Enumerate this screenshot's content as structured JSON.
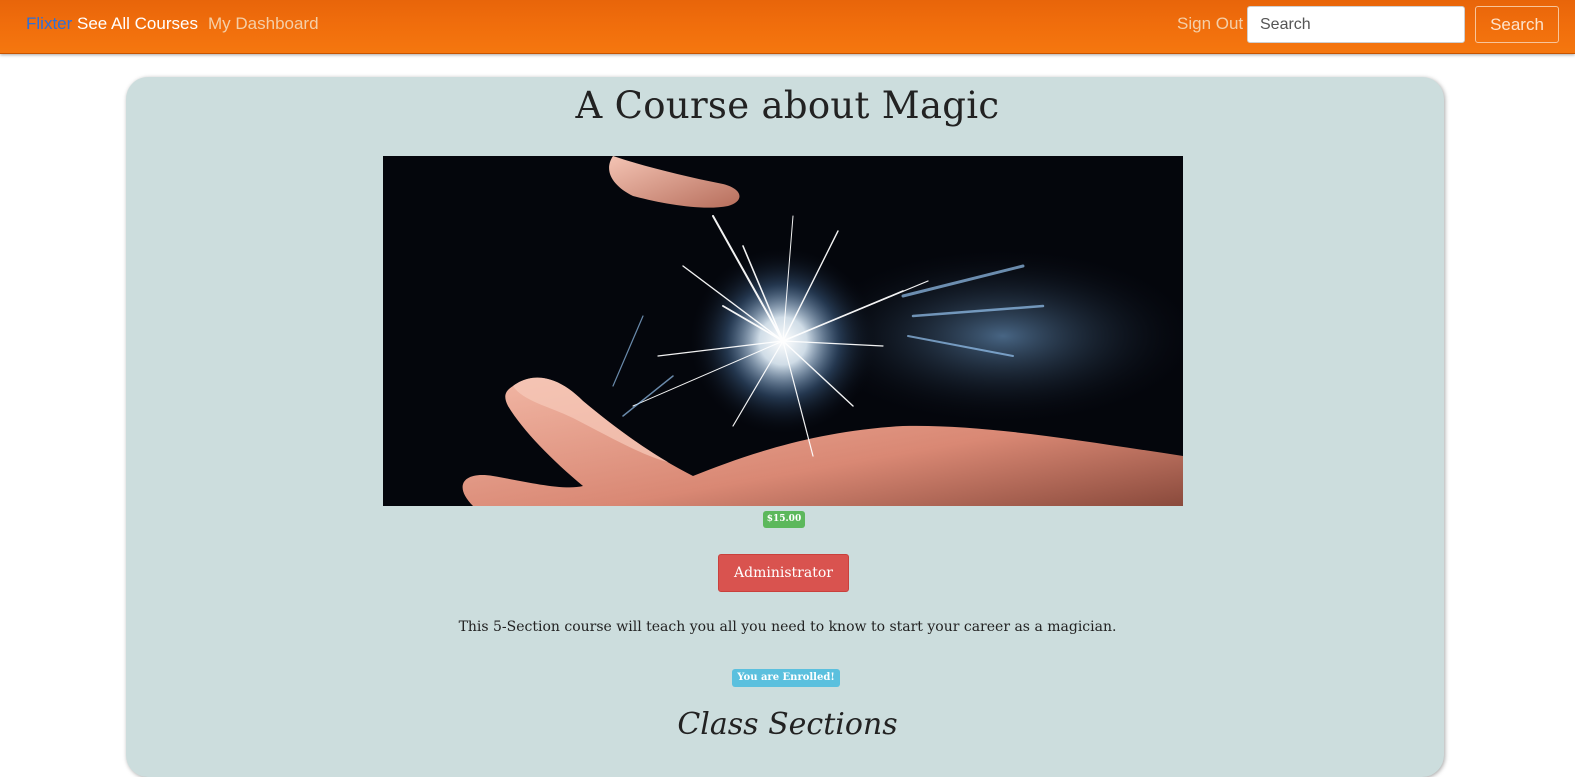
{
  "navbar": {
    "brand": "Flixter",
    "links": {
      "all_courses": "See All Courses",
      "dashboard": "My Dashboard",
      "sign_out": "Sign Out"
    },
    "search": {
      "placeholder": "Search",
      "value": "",
      "button_label": "Search"
    },
    "colors": {
      "bar": "#ee6b0c",
      "brand": "#2f6fd6"
    }
  },
  "course": {
    "title": "A Course about Magic",
    "image_alt": "hands with magic sparks",
    "price": "$15.00",
    "role_button": "Administrator",
    "description": "This 5-Section course will teach you all you need to know to start your career as a magician.",
    "enrollment_status": "You are Enrolled!",
    "sections_heading": "Class Sections",
    "colors": {
      "card_bg": "#ccdddd",
      "price_badge": "#5cb85c",
      "admin_button": "#d9534f",
      "enrolled_badge": "#5bc0de"
    }
  }
}
